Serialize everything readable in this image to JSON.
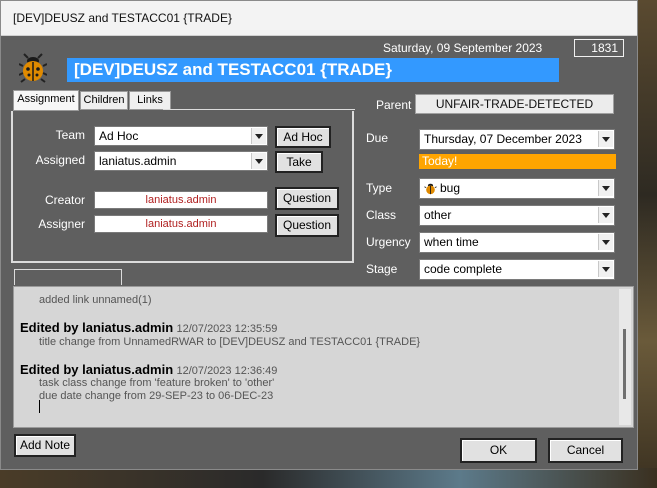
{
  "window": {
    "title": "[DEV]DEUSZ and TESTACC01 {TRADE}"
  },
  "header": {
    "date": "Saturday, 09 September 2023",
    "counter": "1831",
    "task_title": "[DEV]DEUSZ and TESTACC01 {TRADE}",
    "logo_icon": "bug-icon"
  },
  "tabs": [
    {
      "label": "Assignment",
      "active": true
    },
    {
      "label": "Children",
      "active": false
    },
    {
      "label": "Links",
      "active": false
    }
  ],
  "assignment": {
    "team_label": "Team",
    "team_value": "Ad Hoc",
    "adhoc_button": "Ad Hoc",
    "assigned_label": "Assigned",
    "assigned_value": "laniatus.admin",
    "take_button": "Take",
    "creator_label": "Creator",
    "creator_value": "laniatus.admin",
    "creator_question": "Question",
    "assigner_label": "Assigner",
    "assigner_value": "laniatus.admin",
    "assigner_question": "Question"
  },
  "details": {
    "parent_label": "Parent",
    "parent_value": "UNFAIR-TRADE-DETECTED",
    "due_label": "Due",
    "due_value": "Thursday, 07 December 2023",
    "today_badge": "Today!",
    "type_label": "Type",
    "type_value": "bug",
    "class_label": "Class",
    "class_value": "other",
    "urgency_label": "Urgency",
    "urgency_value": "when time",
    "stage_label": "Stage",
    "stage_value": "code complete"
  },
  "log": {
    "first_line": "added link unnamed(1)",
    "entries": [
      {
        "author": "Edited by laniatus.admin",
        "timestamp": "12/07/2023 12:35:59",
        "lines": [
          "title change from UnnamedRWAR to [DEV]DEUSZ and TESTACC01 {TRADE}"
        ]
      },
      {
        "author": "Edited by laniatus.admin",
        "timestamp": "12/07/2023 12:36:49",
        "lines": [
          "task class change from 'feature broken' to 'other'",
          "due date change from 29-SEP-23 to 06-DEC-23"
        ]
      }
    ]
  },
  "footer": {
    "add_note": "Add Note",
    "ok": "OK",
    "cancel": "Cancel"
  },
  "colors": {
    "title_bg": "#3399ff",
    "today_bg": "#ffa500",
    "window_bg": "#5f5f5f"
  }
}
